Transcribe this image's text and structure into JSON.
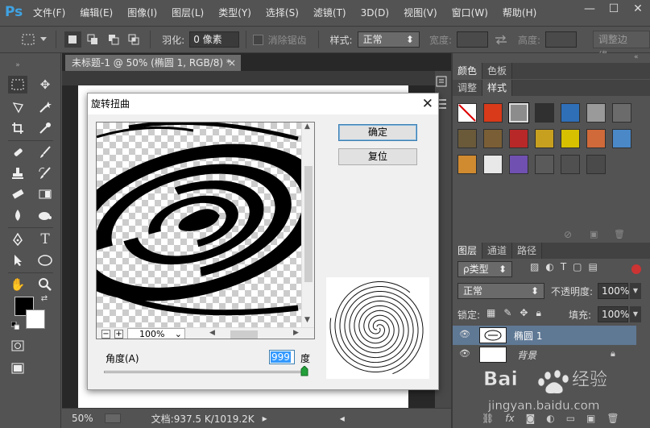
{
  "app": {
    "logo": "Ps"
  },
  "menu": [
    "文件(F)",
    "编辑(E)",
    "图像(I)",
    "图层(L)",
    "类型(Y)",
    "选择(S)",
    "滤镜(T)",
    "3D(D)",
    "视图(V)",
    "窗口(W)",
    "帮助(H)"
  ],
  "window_controls": {
    "minimize": "—",
    "maximize": "☐",
    "close": "✕"
  },
  "options_bar": {
    "feather_label": "羽化:",
    "feather_value": "0 像素",
    "antialias_label": "消除锯齿",
    "style_label": "样式:",
    "style_value": "正常",
    "width_label": "宽度:",
    "height_label": "高度:",
    "refine_edge_button": "调整边缘..."
  },
  "document": {
    "tab_title": "未标题-1 @ 50% (椭圆 1, RGB/8) *",
    "tab_close": "×",
    "zoom": "50%",
    "doc_info": "文档:937.5 K/1019.2K"
  },
  "panels": {
    "color_tabs": [
      "颜色",
      "色板"
    ],
    "style_tabs": [
      "调整",
      "样式"
    ],
    "layer_tabs": [
      "图层",
      "通道",
      "路径"
    ],
    "kind_filter": "ρ类型",
    "blend_mode": "正常",
    "opacity_label": "不透明度:",
    "opacity_value": "100%",
    "lock_label": "锁定:",
    "fill_label": "填充:",
    "fill_value": "100%",
    "layers": [
      {
        "name": "椭圆 1",
        "selected": true
      },
      {
        "name": "背景",
        "selected": false
      }
    ],
    "style_swatch_colors": [
      "#ffffff",
      "#d83a1a",
      "#8c8c8c",
      "#303030",
      "#2f6fb8",
      "#9a9a9a",
      "#6b6b6b",
      "#6a5a3a",
      "#7a5f36",
      "#b82828",
      "#c8a020",
      "#d6c000",
      "#d06a3a",
      "#4a88c8",
      "#d08a30",
      "#e8e8e8",
      "#7050b0",
      "#5a5a5a",
      "#505050",
      "#4a4a4a"
    ]
  },
  "dialog": {
    "title": "旋转扭曲",
    "close": "✕",
    "ok_button": "确定",
    "reset_button": "复位",
    "zoom_value": "100%",
    "zoom_minus": "−",
    "zoom_plus": "+",
    "angle_label": "角度(A)",
    "angle_value": "999",
    "angle_unit": "度",
    "angle_fraction": 1.0
  },
  "watermark": {
    "brand": "Bai",
    "brand2": "经验",
    "url": "jingyan.baidu.com"
  }
}
